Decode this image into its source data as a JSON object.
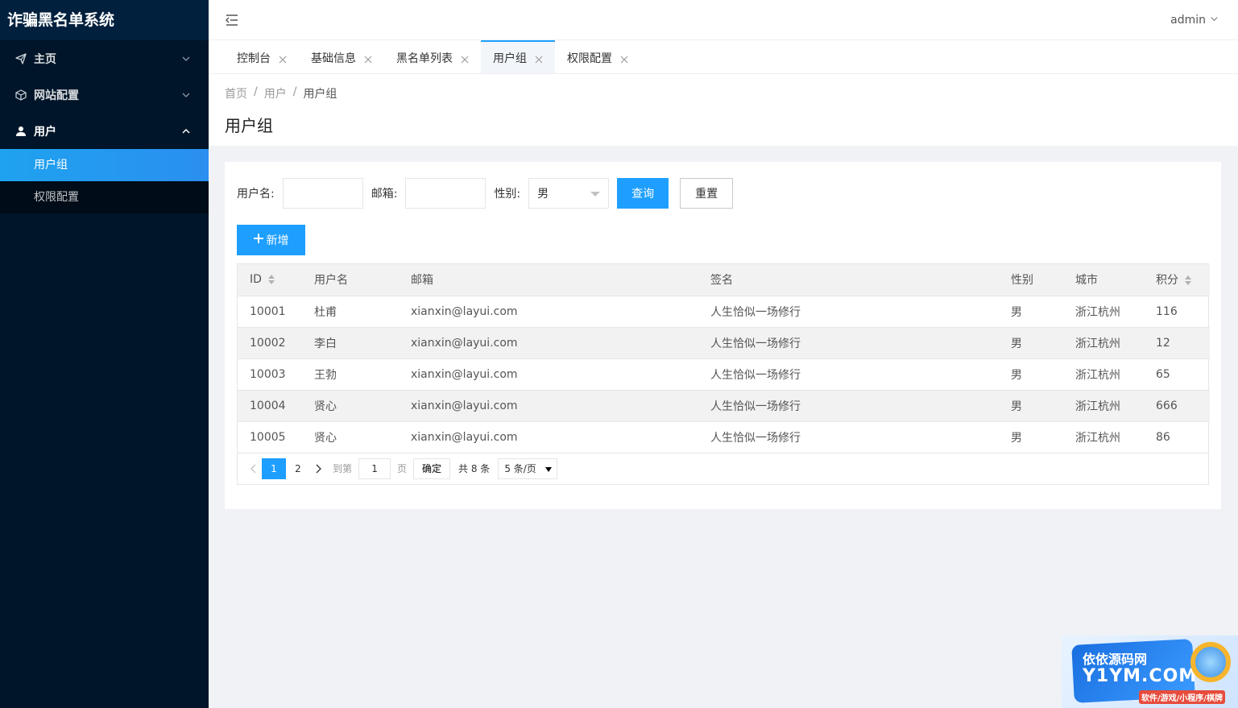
{
  "app": {
    "title": "诈骗黑名单系统"
  },
  "sidebar": {
    "items": [
      {
        "label": "主页",
        "icon": "paper-plane-icon"
      },
      {
        "label": "网站配置",
        "icon": "cube-icon"
      },
      {
        "label": "用户",
        "icon": "user-icon"
      }
    ],
    "submenu": [
      {
        "label": "用户组",
        "active": true
      },
      {
        "label": "权限配置",
        "active": false
      }
    ]
  },
  "header": {
    "user": "admin"
  },
  "tabs": [
    {
      "label": "控制台"
    },
    {
      "label": "基础信息"
    },
    {
      "label": "黑名单列表"
    },
    {
      "label": "用户组",
      "active": true
    },
    {
      "label": "权限配置"
    }
  ],
  "breadcrumb": {
    "home": "首页",
    "section": "用户",
    "current": "用户组"
  },
  "page": {
    "title": "用户组"
  },
  "filters": {
    "username_label": "用户名:",
    "email_label": "邮箱:",
    "gender_label": "性别:",
    "gender_value": "男",
    "search_label": "查询",
    "reset_label": "重置"
  },
  "add_button": {
    "label": "新增"
  },
  "table": {
    "headers": [
      "ID",
      "用户名",
      "邮箱",
      "签名",
      "性别",
      "城市",
      "积分"
    ],
    "rows": [
      [
        "10001",
        "杜甫",
        "xianxin@layui.com",
        "人生恰似一场修行",
        "男",
        "浙江杭州",
        "116"
      ],
      [
        "10002",
        "李白",
        "xianxin@layui.com",
        "人生恰似一场修行",
        "男",
        "浙江杭州",
        "12"
      ],
      [
        "10003",
        "王勃",
        "xianxin@layui.com",
        "人生恰似一场修行",
        "男",
        "浙江杭州",
        "65"
      ],
      [
        "10004",
        "贤心",
        "xianxin@layui.com",
        "人生恰似一场修行",
        "男",
        "浙江杭州",
        "666"
      ],
      [
        "10005",
        "贤心",
        "xianxin@layui.com",
        "人生恰似一场修行",
        "男",
        "浙江杭州",
        "86"
      ]
    ]
  },
  "pager": {
    "pages": [
      "1",
      "2"
    ],
    "current": "1",
    "goto_label": "到第",
    "goto_value": "1",
    "page_label": "页",
    "confirm_label": "确定",
    "total": "共 8 条",
    "page_size": "5 条/页"
  },
  "watermark": {
    "line1": "依依源码网",
    "line2": "Y1YM.COM",
    "line3": "软件/游戏/小程序/棋牌"
  },
  "colors": {
    "sidebar_bg": "#001529",
    "accent": "#1e9fff"
  }
}
